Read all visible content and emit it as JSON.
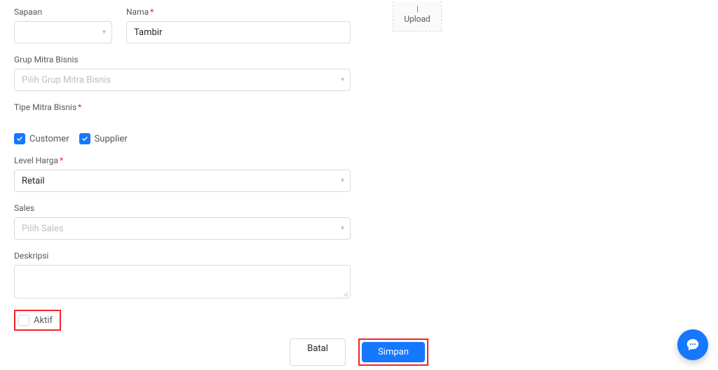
{
  "upload": {
    "label": "Upload"
  },
  "sapaan": {
    "label": "Sapaan",
    "value": ""
  },
  "nama": {
    "label": "Nama",
    "value": "Tambir"
  },
  "grup": {
    "label": "Grup Mitra Bisnis",
    "placeholder": "Pilih Grup Mitra Bisnis"
  },
  "tipe": {
    "label": "Tipe Mitra Bisnis",
    "customer_label": "Customer",
    "supplier_label": "Supplier"
  },
  "level": {
    "label": "Level Harga",
    "value": "Retail"
  },
  "sales": {
    "label": "Sales",
    "placeholder": "Pilih Sales"
  },
  "deskripsi": {
    "label": "Deskripsi",
    "value": ""
  },
  "aktif": {
    "label": "Aktif"
  },
  "footer": {
    "cancel": "Batal",
    "save": "Simpan"
  }
}
